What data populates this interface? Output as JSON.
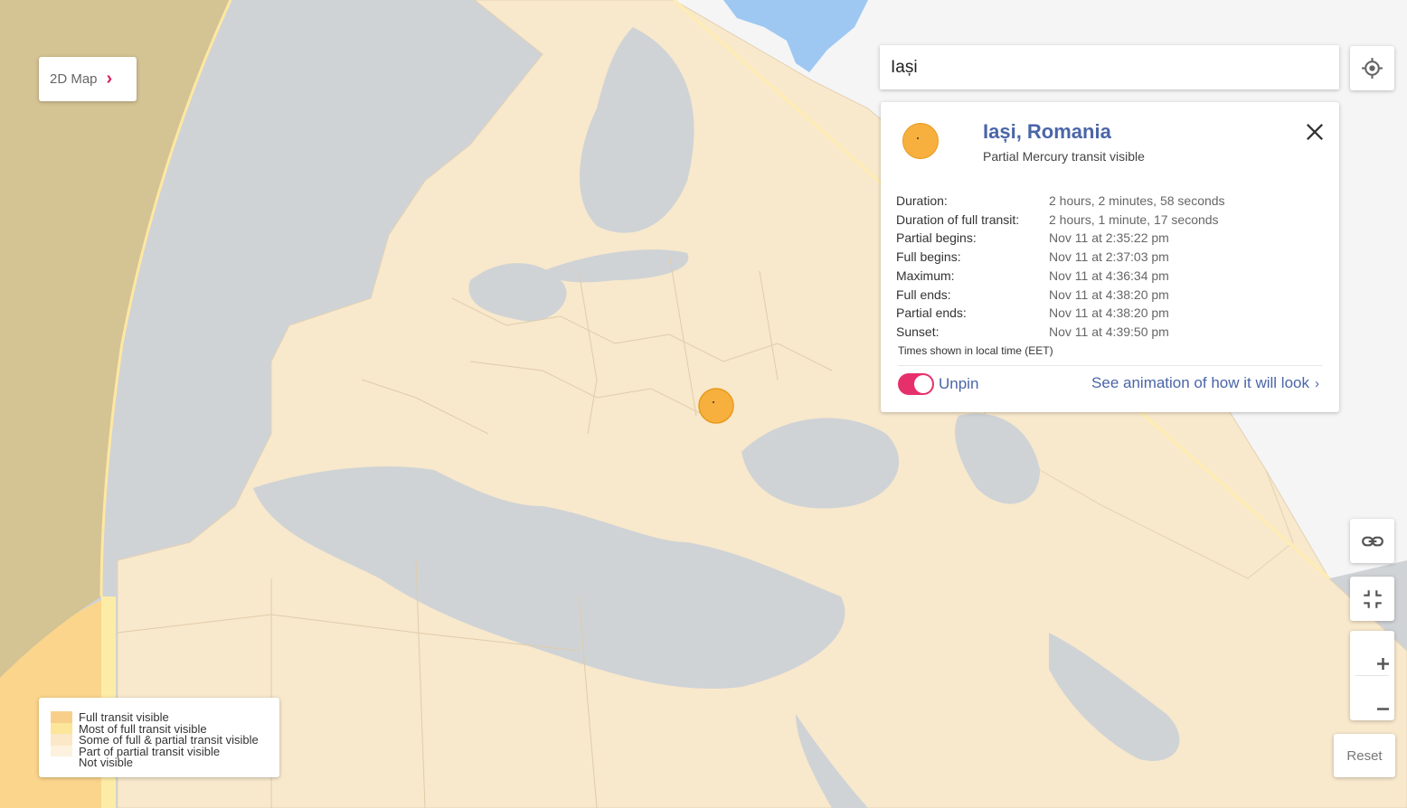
{
  "mode_button": {
    "label": "2D Map",
    "chevron": "›"
  },
  "search": {
    "value": "Iași"
  },
  "locate_icon": "crosshair-icon",
  "marker": {
    "location": "Iași, Romania",
    "color": "#f7b03e"
  },
  "info_panel": {
    "title": "Iași, Romania",
    "subtitle": "Partial Mercury transit visible",
    "close_icon": "close-icon",
    "rows": [
      {
        "label": "Duration:",
        "value": "2 hours, 2 minutes, 58 seconds"
      },
      {
        "label": "Duration of full transit:",
        "value": "2 hours, 1 minute, 17 seconds"
      },
      {
        "label": "Partial begins:",
        "value": "Nov 11 at 2:35:22 pm"
      },
      {
        "label": "Full begins:",
        "value": "Nov 11 at 2:37:03 pm"
      },
      {
        "label": "Maximum:",
        "value": "Nov 11 at 4:36:34 pm"
      },
      {
        "label": "Full ends:",
        "value": "Nov 11 at 4:38:20 pm"
      },
      {
        "label": "Partial ends:",
        "value": "Nov 11 at 4:38:20 pm"
      },
      {
        "label": "Sunset:",
        "value": "Nov 11 at 4:39:50 pm"
      }
    ],
    "note": "Times shown in local time (EET)",
    "pin_toggle": {
      "on": true,
      "label": "Unpin"
    },
    "animation_link": {
      "label": "See animation of how it will look",
      "chevron": "›"
    }
  },
  "controls": {
    "link_icon": "link-icon",
    "fullscreen_icon": "exit-fullscreen-icon",
    "zoom_in": "+",
    "zoom_out": "−",
    "reset_label": "Reset"
  },
  "legend": {
    "items": [
      {
        "label": "Full transit visible",
        "color": "#f8cf8a"
      },
      {
        "label": "Most of full transit visible",
        "color": "#fbe69a"
      },
      {
        "label": "Some of full & partial transit visible",
        "color": "#fbe8c8"
      },
      {
        "label": "Part of partial transit visible",
        "color": "#fdf2de"
      },
      {
        "label": "Not visible",
        "color": "#ffffff"
      }
    ]
  },
  "colors": {
    "water": "#cfd3d6",
    "land_partial": "#f8e8cc",
    "land_full": "#fbd58c",
    "band_yellow": "#fdeca6",
    "night_band": "#d4c393",
    "not_visible": "#f5f5f6",
    "lakes": "#9ec8f2",
    "accent": "#d81b60",
    "link": "#4a65a8"
  }
}
